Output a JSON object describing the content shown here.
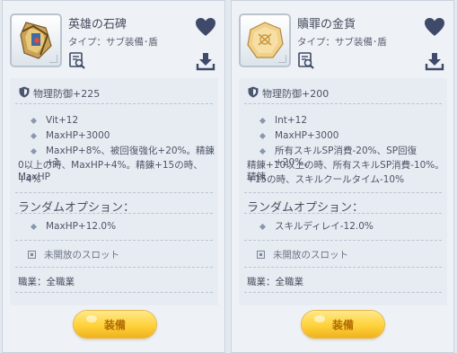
{
  "cards": [
    {
      "name": "英雄の石碑",
      "type": "タイプ：サブ装備･盾",
      "defense": "物理防御+225",
      "stats": [
        {
          "lines": [
            "Vit+12"
          ]
        },
        {
          "lines": [
            "MaxHP+3000"
          ]
        },
        {
          "lines": [
            "MaxHP+8%、被回復強化+20%。精錬+1",
            "0以上の時、MaxHP+4%。精錬+15の時、MaxHP",
            "+4%"
          ]
        }
      ],
      "random_title": "ランダムオプション：",
      "random_options": [
        "MaxHP+12.0%"
      ],
      "slot_text": "未開放のスロット",
      "job": "職業：全職業",
      "equip_label": "装備"
    },
    {
      "name": "贖罪の金貨",
      "type": "タイプ：サブ装備･盾",
      "defense": "物理防御+200",
      "stats": [
        {
          "lines": [
            "Int+12"
          ]
        },
        {
          "lines": [
            "MaxHP+3000"
          ]
        },
        {
          "lines": [
            "所有スキルSP消費-20%、SP回復+20%。",
            "精錬+10以上の時、所有スキルSP消費-10%。精錬",
            "+15の時、スキルクールタイム-10%"
          ]
        }
      ],
      "random_title": "ランダムオプション：",
      "random_options": [
        "スキルディレイ-12.0%"
      ],
      "slot_text": "未開放のスロット",
      "job": "職業：全職業",
      "equip_label": "装備"
    }
  ]
}
